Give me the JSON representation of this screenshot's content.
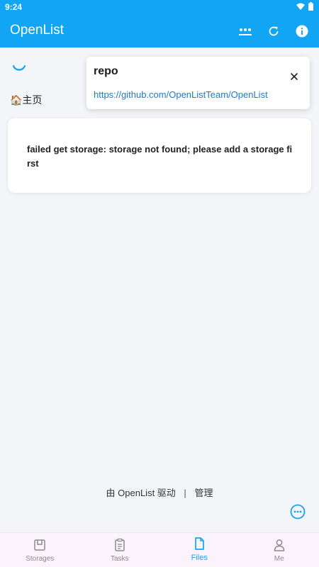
{
  "statusbar": {
    "time": "9:24"
  },
  "appbar": {
    "title": "OpenList",
    "actions": [
      "more-icon",
      "refresh-icon",
      "info-icon"
    ]
  },
  "breadcrumb": {
    "home_label": "🏠主页"
  },
  "toast": {
    "title": "repo",
    "link": "https://github.com/OpenListTeam/OpenList"
  },
  "error": {
    "message": "failed get storage: storage not found; please add a storage first"
  },
  "footer": {
    "powered_by": "由 OpenList 驱动",
    "separator": "|",
    "manage": "管理"
  },
  "nav": {
    "items": [
      {
        "label": "Storages",
        "icon": "storage-icon"
      },
      {
        "label": "Tasks",
        "icon": "clipboard-icon"
      },
      {
        "label": "Files",
        "icon": "file-icon",
        "active": true
      },
      {
        "label": "Me",
        "icon": "person-icon"
      }
    ]
  },
  "colors": {
    "primary": "#12a5f4",
    "background": "#f4f5f9",
    "nav_background": "#fbf3fb",
    "link": "#1e78d8"
  }
}
